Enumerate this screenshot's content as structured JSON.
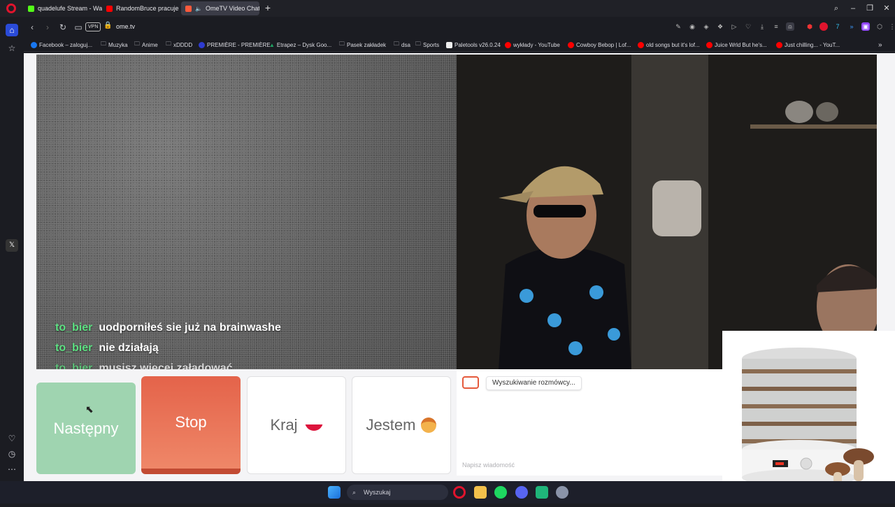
{
  "tabs": [
    {
      "title": "quadelufe Stream - Watch",
      "favicon_color": "#53fc18",
      "active": false
    },
    {
      "title": "RandomBruce pracuje bo",
      "favicon_color": "#ff0000",
      "active": false
    },
    {
      "title": "OmeTV Video Chat -",
      "favicon_color": "#ff5a3c",
      "active": true
    }
  ],
  "address": {
    "url": "ome.tv",
    "vpn_label": "VPN"
  },
  "bookmarks": [
    {
      "label": "Facebook – zaloguj...",
      "icon_color": "#1877f2"
    },
    {
      "label": "Muzyka",
      "icon_color": "folder"
    },
    {
      "label": "Anime",
      "icon_color": "folder"
    },
    {
      "label": "xDDDD",
      "icon_color": "folder"
    },
    {
      "label": "PREMIÈRE - PREMIÈRE",
      "icon_color": "#2e3bd1"
    },
    {
      "label": "Etrapez – Dysk Goo...",
      "icon_color": "#1fa463"
    },
    {
      "label": "Pasek zakładek",
      "icon_color": "folder"
    },
    {
      "label": "dsa",
      "icon_color": "folder"
    },
    {
      "label": "Sports",
      "icon_color": "folder"
    },
    {
      "label": "Paletools v26.0.24",
      "icon_color": "#eeeeee"
    },
    {
      "label": "wykłady - YouTube",
      "icon_color": "#ff0000"
    },
    {
      "label": "Cowboy Bebop | Lof...",
      "icon_color": "#ff0000"
    },
    {
      "label": "old songs but it's lof...",
      "icon_color": "#ff0000"
    },
    {
      "label": "Juice Wrld But he's...",
      "icon_color": "#ff0000"
    },
    {
      "label": "Just chilling... - YouT...",
      "icon_color": "#ff0000"
    }
  ],
  "chat_overlay": [
    {
      "user": "to_bier",
      "text": "uodporniłeś sie już na brainwashe"
    },
    {
      "user": "to_bier",
      "text": "nie działają"
    },
    {
      "user": "to_bier",
      "text": "musisz więcej załadować"
    }
  ],
  "controls": {
    "next_label": "Następny",
    "stop_label": "Stop",
    "country_label": "Kraj",
    "iam_label": "Jestem"
  },
  "chat_panel": {
    "status": "Wyszukiwanie rozmówcy...",
    "input_placeholder": "Napisz wiadomość"
  },
  "taskbar": {
    "search_placeholder": "Wyszukaj"
  },
  "colors": {
    "accent_green": "#5de082",
    "stop_red": "#e4634a",
    "next_green": "#9fd4b0"
  }
}
